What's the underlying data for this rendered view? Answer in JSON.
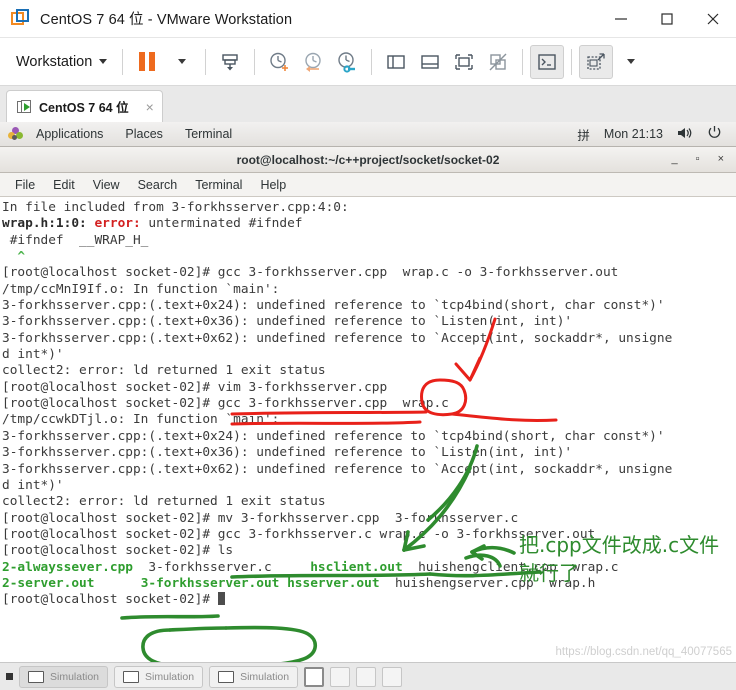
{
  "window": {
    "title": "CentOS 7 64 位 - VMware Workstation",
    "controls": {
      "minimize": "minimize-icon",
      "maximize": "maximize-icon",
      "close": "close-icon"
    }
  },
  "toolbar": {
    "menu_label": "Workstation",
    "buttons": [
      "pause-button",
      "pause-dropdown",
      "send-ctrl-alt-del-button",
      "snapshot-take-button",
      "snapshot-revert-button",
      "snapshot-manager-button",
      "show-library-button",
      "show-thumbnail-bar-button",
      "fullscreen-button",
      "unity-mode-button",
      "console-view-button",
      "stretch-guest-button",
      "stretch-dropdown"
    ]
  },
  "tab": {
    "label": "CentOS 7 64 位",
    "close": "×"
  },
  "guest": {
    "panel": {
      "applications": "Applications",
      "places": "Places",
      "terminal": "Terminal",
      "input_method": "拼",
      "clock": "Mon 21:13",
      "volume_icon": "volume-icon",
      "power_icon": "power-icon"
    },
    "terminal": {
      "title": "root@localhost:~/c++project/socket/socket-02",
      "menus": [
        "File",
        "Edit",
        "View",
        "Search",
        "Terminal",
        "Help"
      ],
      "win_buttons": {
        "minimize": "_",
        "maximize": "▫",
        "close": "×"
      },
      "lines": [
        "In file included from 3-forkhsserver.cpp:4:0:",
        "wrap.h:1:0: error: unterminated #ifndef",
        " #ifndef  __WRAP_H_",
        "  ^",
        "[root@localhost socket-02]# gcc 3-forkhsserver.cpp  wrap.c -o 3-forkhsserver.out",
        "/tmp/ccMnI9If.o: In function `main':",
        "3-forkhsserver.cpp:(.text+0x24): undefined reference to `tcp4bind(short, char const*)'",
        "3-forkhsserver.cpp:(.text+0x36): undefined reference to `Listen(int, int)'",
        "3-forkhsserver.cpp:(.text+0x62): undefined reference to `Accept(int, sockaddr*, unsigne",
        "d int*)'",
        "collect2: error: ld returned 1 exit status",
        "[root@localhost socket-02]# vim 3-forkhsserver.cpp",
        "[root@localhost socket-02]# gcc 3-forkhsserver.cpp  wrap.c",
        "/tmp/ccwkDTjl.o: In function `main':",
        "3-forkhsserver.cpp:(.text+0x24): undefined reference to `tcp4bind(short, char const*)'",
        "3-forkhsserver.cpp:(.text+0x36): undefined reference to `Listen(int, int)'",
        "3-forkhsserver.cpp:(.text+0x62): undefined reference to `Accept(int, sockaddr*, unsigne",
        "d int*)'",
        "collect2: error: ld returned 1 exit status",
        "[root@localhost socket-02]# mv 3-forkhsserver.cpp  3-forkhsserver.c",
        "[root@localhost socket-02]# gcc 3-forkhsserver.c wrap.c -o 3-forkhsserver.out",
        "[root@localhost socket-02]# ls"
      ],
      "ls_output": {
        "row1": [
          "2-alwayssever.cpp",
          "3-forkhsserver.c",
          "hsclient.out",
          "huishengclient.cpp",
          "wrap.c"
        ],
        "row2": [
          "2-server.out",
          "3-forkhsserver.out",
          "hsserver.out",
          "huishengserver.cpp",
          "wrap.h"
        ]
      },
      "prompt": "[root@localhost socket-02]# "
    },
    "annotations": {
      "chinese_note": "把.cpp文件改成.c文件就行了",
      "red_color": "#e8211a",
      "green_color": "#2e8b2e"
    }
  },
  "watermark": "https://blog.csdn.net/qq_40077565",
  "statusbar": {
    "chips": [
      "Simulation",
      "Simulation",
      "Simulation"
    ]
  }
}
